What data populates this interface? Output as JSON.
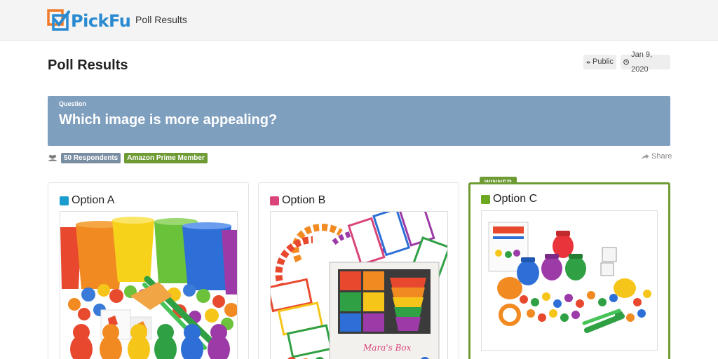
{
  "nav": {
    "logo_text": "PickFu",
    "title": "Poll Results"
  },
  "header": {
    "title": "Poll Results",
    "visibility": "Public",
    "date": "Jan 9, 2020"
  },
  "question": {
    "label": "Question",
    "text": "Which image is more appealing?"
  },
  "badges": {
    "respondents": "50 Respondents",
    "audience": "Amazon Prime Member"
  },
  "share_label": "Share",
  "winner_label": "WINNER",
  "options": [
    {
      "label": "Option A",
      "color": "#1b9ccf"
    },
    {
      "label": "Option B",
      "color": "#d9457a"
    },
    {
      "label": "Option C",
      "color": "#6ca921"
    }
  ],
  "colors": {
    "question_bg": "#7f9fbf",
    "winner": "#6f9b35",
    "brand_blue": "#2a8ad0",
    "brand_orange": "#f07a2a"
  }
}
